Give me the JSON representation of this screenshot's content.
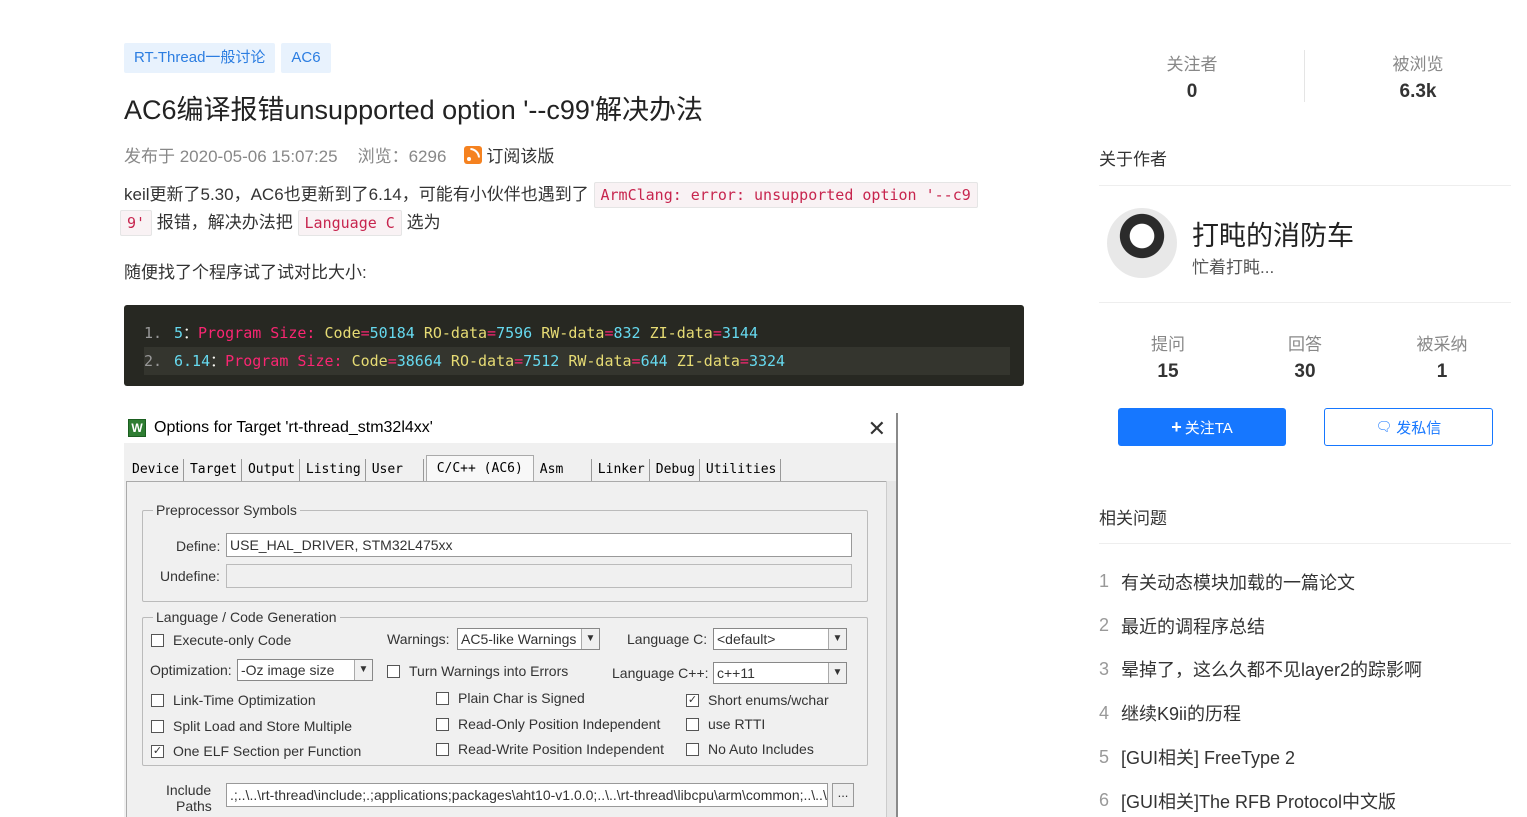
{
  "article": {
    "tags": [
      "RT-Thread一般讨论",
      "AC6"
    ],
    "title": "AC6编译报错unsupported option '--c99'解决办法",
    "published": "发布于 2020-05-06 15:07:25",
    "views": "浏览：6296",
    "subscribe": "订阅该版",
    "p1_text": "keil更新了5.30，AC6也更新到了6.14，可能有小伙伴也遇到了",
    "p1_code": "ArmClang: error: unsupported option '--c9",
    "p2_code_tail": "9'",
    "p2_mid": "报错，解决办法把",
    "p2_code": "Language C",
    "p2_end": "选为",
    "p3": "随便找了个程序试了试对比大小:",
    "code_lines": [
      {
        "num": "1.",
        "ver": "5",
        "colon": "：",
        "label": "Program Size:",
        "code_k": "Code",
        "code_v": "50184",
        "ro_k": "RO-data",
        "ro_v": "7596",
        "rw_k": "RW-data",
        "rw_v": "832",
        "zi_k": "ZI-data",
        "zi_v": "3144"
      },
      {
        "num": "2.",
        "ver": "6.14",
        "colon": "：",
        "label": "Program Size:",
        "code_k": "Code",
        "code_v": "38664",
        "ro_k": "RO-data",
        "ro_v": "7512",
        "rw_k": "RW-data",
        "rw_v": "644",
        "zi_k": "ZI-data",
        "zi_v": "3324"
      }
    ]
  },
  "dialog": {
    "title": "Options for Target 'rt-thread_stm32l4xx'",
    "close": "✕",
    "tabs": [
      "Device",
      "Target",
      "Output",
      "Listing",
      "User",
      "C/C++ (AC6)",
      "Asm",
      "Linker",
      "Debug",
      "Utilities"
    ],
    "preprocessor": {
      "legend": "Preprocessor Symbols",
      "define_label": "Define:",
      "define_value": "USE_HAL_DRIVER, STM32L475xx",
      "undefine_label": "Undefine:",
      "undefine_value": ""
    },
    "langgen": {
      "legend": "Language / Code Generation",
      "execute_only": "Execute-only Code",
      "warnings_label": "Warnings:",
      "warnings_value": "AC5-like Warnings",
      "language_c_label": "Language C:",
      "language_c_value": "<default>",
      "optimization_label": "Optimization:",
      "optimization_value": "-Oz image size",
      "turn_warnings": "Turn Warnings into Errors",
      "language_cpp_label": "Language C++:",
      "language_cpp_value": "c++11",
      "lto": "Link-Time Optimization",
      "plain_char": "Plain Char is Signed",
      "short_enums": "Short enums/wchar",
      "split_load": "Split Load and Store Multiple",
      "ropi": "Read-Only Position Independent",
      "use_rtti": "use RTTI",
      "one_elf": "One ELF Section per Function",
      "rwpi": "Read-Write Position Independent",
      "no_auto_includes": "No Auto Includes"
    },
    "include_label_1": "Include",
    "include_label_2": "Paths",
    "include_value": ".;..\\..\\rt-thread\\include;.;applications;packages\\aht10-v1.0.0;..\\..\\rt-thread\\libcpu\\arm\\common;..\\..\\r",
    "browse": "..."
  },
  "sidebar": {
    "followers_label": "关注者",
    "followers_value": "0",
    "views_label": "被浏览",
    "views_value": "6.3k",
    "about_author": "关于作者",
    "author_name": "打盹的消防车",
    "author_sig": "忙着打盹...",
    "questions_label": "提问",
    "questions_value": "15",
    "answers_label": "回答",
    "answers_value": "30",
    "accepted_label": "被采纳",
    "accepted_value": "1",
    "follow_btn": "关注TA",
    "message_btn": "发私信",
    "related_title": "相关问题",
    "related": [
      {
        "num": "1",
        "text": "有关动态模块加载的一篇论文"
      },
      {
        "num": "2",
        "text": "最近的调程序总结"
      },
      {
        "num": "3",
        "text": "晕掉了，这么久都不见layer2的踪影啊"
      },
      {
        "num": "4",
        "text": "继续K9ii的历程"
      },
      {
        "num": "5",
        "text": "[GUI相关] FreeType 2"
      },
      {
        "num": "6",
        "text": "[GUI相关]The RFB Protocol中文版"
      }
    ]
  },
  "colors": {
    "accent": "#1677ff",
    "tag_bg": "#e8f2fd",
    "tag_text": "#2b7de1",
    "code_bg": "#272822",
    "inline_code": "#c7254e",
    "rss": "#f58220"
  },
  "icons": {
    "rss": "rss-icon",
    "plus": "plus-icon",
    "chat": "chat-icon",
    "dialog_app": "keil-app-icon",
    "close": "close-icon"
  }
}
